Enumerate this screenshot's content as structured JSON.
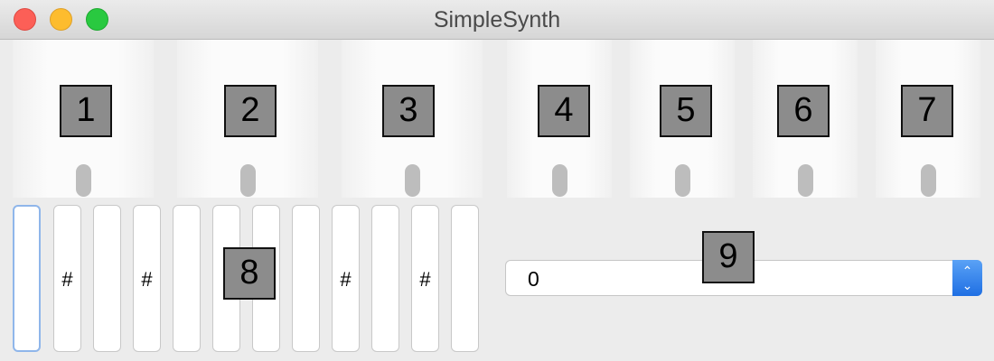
{
  "window": {
    "title": "SimpleSynth"
  },
  "markers": [
    "1",
    "2",
    "3",
    "4",
    "5",
    "6",
    "7",
    "8",
    "9"
  ],
  "keys": [
    "",
    "#",
    "",
    "#",
    "",
    "",
    "",
    "",
    "#",
    "",
    "#",
    ""
  ],
  "select": {
    "value": "0"
  },
  "icons": {
    "stepper": "up-down-stepper-icon"
  }
}
